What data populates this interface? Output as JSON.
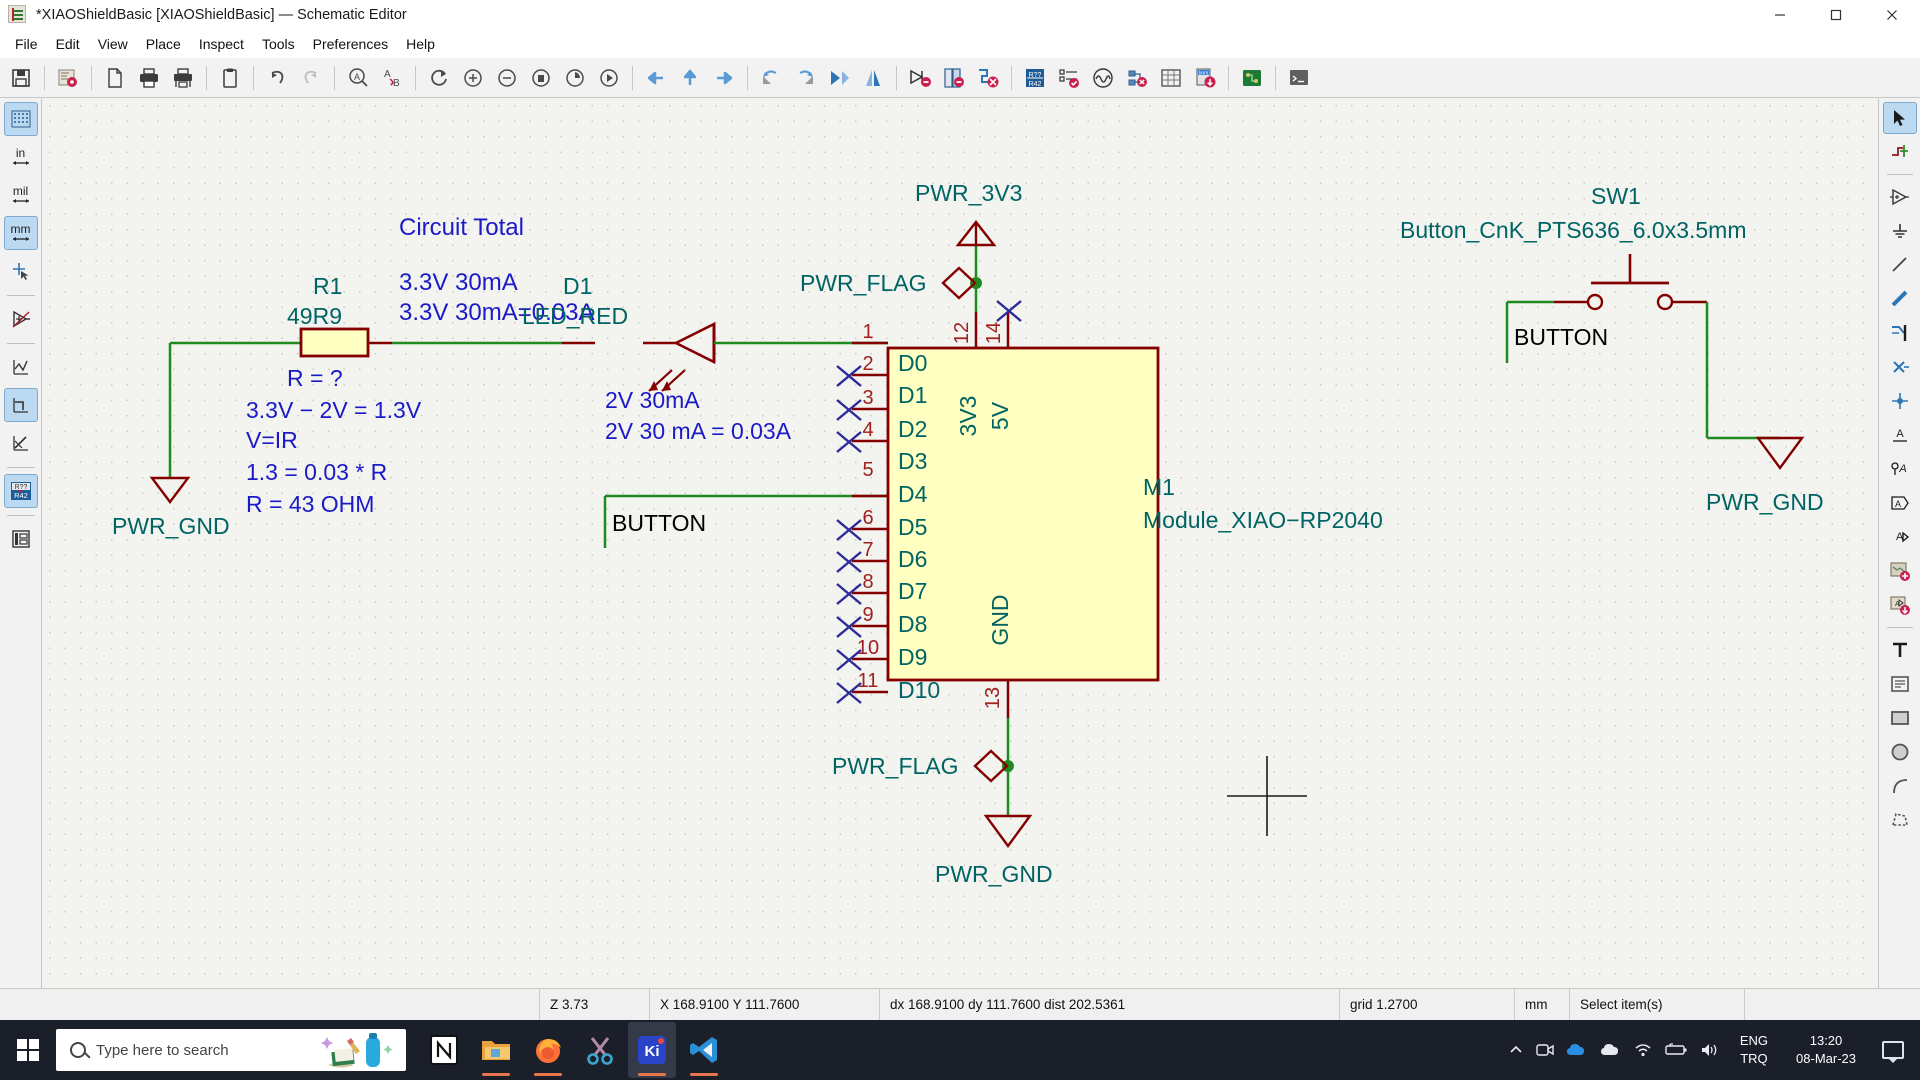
{
  "window": {
    "title": "*XIAOShieldBasic [XIAOShieldBasic] — Schematic Editor",
    "app_icon": "kicad-icon",
    "minimize": "—",
    "maximize": "❐",
    "close": "✕"
  },
  "menubar": {
    "items": [
      {
        "label": "File"
      },
      {
        "label": "Edit"
      },
      {
        "label": "View"
      },
      {
        "label": "Place"
      },
      {
        "label": "Inspect"
      },
      {
        "label": "Tools"
      },
      {
        "label": "Preferences"
      },
      {
        "label": "Help"
      }
    ]
  },
  "toolbar": {
    "buttons": [
      {
        "name": "save-icon"
      },
      {
        "name": "schematic-setup-icon"
      },
      {
        "name": "page-settings-icon"
      },
      {
        "name": "print-icon"
      },
      {
        "name": "plot-icon"
      },
      {
        "name": "paste-icon"
      },
      {
        "name": "undo-icon"
      },
      {
        "name": "redo-icon"
      },
      {
        "name": "find-icon"
      },
      {
        "name": "find-replace-icon"
      },
      {
        "name": "refresh-icon"
      },
      {
        "name": "zoom-in-icon"
      },
      {
        "name": "zoom-out-icon"
      },
      {
        "name": "zoom-fit-icon"
      },
      {
        "name": "zoom-objects-icon"
      },
      {
        "name": "zoom-selection-icon"
      },
      {
        "name": "leave-sheet-icon"
      },
      {
        "name": "up-sheet-icon"
      },
      {
        "name": "enter-sheet-icon"
      },
      {
        "name": "rotate-ccw-icon"
      },
      {
        "name": "rotate-cw-icon"
      },
      {
        "name": "mirror-horizontal-icon"
      },
      {
        "name": "mirror-vertical-icon"
      },
      {
        "name": "annotate-icon"
      },
      {
        "name": "symbol-checker-icon"
      },
      {
        "name": "erc-icon"
      },
      {
        "name": "assign-footprints-icon"
      },
      {
        "name": "edit-symbol-fields-icon"
      },
      {
        "name": "simulator-icon"
      },
      {
        "name": "netlist-icon"
      },
      {
        "name": "bom-table-icon"
      },
      {
        "name": "generate-bom-icon"
      },
      {
        "name": "open-pcb-icon"
      },
      {
        "name": "scripting-console-icon"
      }
    ]
  },
  "left_toolbar": {
    "buttons": [
      {
        "name": "toggle-grid-icon",
        "label": "",
        "active": true
      },
      {
        "name": "units-inch-icon",
        "label": "in",
        "active": false
      },
      {
        "name": "units-mil-icon",
        "label": "mil",
        "active": false
      },
      {
        "name": "units-mm-icon",
        "label": "mm",
        "active": true
      },
      {
        "name": "full-crosshair-icon",
        "label": "",
        "active": false
      },
      {
        "name": "invisible-pins-icon",
        "label": "",
        "active": false
      },
      {
        "name": "free-angle-lines-icon",
        "label": "",
        "active": false
      },
      {
        "name": "hv-lines-icon",
        "label": "",
        "active": true
      },
      {
        "name": "any-angle-lines-icon",
        "label": "",
        "active": false
      },
      {
        "name": "annotation-overlay-icon",
        "label": "R?? R42",
        "active": true
      },
      {
        "name": "hierarchy-navigator-icon",
        "label": "",
        "active": false
      }
    ]
  },
  "right_toolbar": {
    "buttons": [
      {
        "name": "select-tool-icon",
        "active": true
      },
      {
        "name": "highlight-net-icon",
        "active": false
      },
      {
        "name": "place-symbol-icon",
        "active": false
      },
      {
        "name": "place-power-icon",
        "active": false
      },
      {
        "name": "draw-wire-icon",
        "active": false
      },
      {
        "name": "draw-bus-icon",
        "active": false
      },
      {
        "name": "wire-to-bus-entry-icon",
        "active": false
      },
      {
        "name": "no-connect-flag-icon",
        "active": false
      },
      {
        "name": "junction-icon",
        "active": false
      },
      {
        "name": "net-label-icon",
        "active": false
      },
      {
        "name": "global-label-icon",
        "active": false
      },
      {
        "name": "hierarchical-label-icon",
        "active": false
      },
      {
        "name": "sheet-pin-icon",
        "active": false
      },
      {
        "name": "add-sheet-icon",
        "active": false
      },
      {
        "name": "import-sheet-pin-icon",
        "active": false
      },
      {
        "name": "add-text-icon",
        "active": false
      },
      {
        "name": "add-textbox-icon",
        "active": false
      },
      {
        "name": "draw-rectangle-icon",
        "active": false
      },
      {
        "name": "draw-circle-icon",
        "active": false
      },
      {
        "name": "draw-arc-icon",
        "active": false
      },
      {
        "name": "draw-polygon-icon",
        "active": false
      }
    ]
  },
  "schematic": {
    "notes": {
      "circuit_total_title": "Circuit Total",
      "circuit_total_line1": "3.3V 30mA",
      "circuit_total_line2": "3.3V 30mA=0.03A",
      "resistor_calc_q": "R = ?",
      "resistor_calc_l1": "3.3V − 2V = 1.3V",
      "resistor_calc_l2": "V=IR",
      "resistor_calc_l3": "1.3 = 0.03 * R",
      "resistor_calc_l4": "R = 43 OHM",
      "led_note_l1": "2V 30mA",
      "led_note_l2": "2V 30 mA = 0.03A"
    },
    "components": {
      "r1": {
        "ref": "R1",
        "value": "49R9"
      },
      "d1": {
        "ref": "D1",
        "value": "LED_RED"
      },
      "m1": {
        "ref": "M1",
        "value": "Module_XIAO−RP2040"
      },
      "sw1": {
        "ref": "SW1",
        "value": "Button_CnK_PTS636_6.0x3.5mm"
      }
    },
    "power_symbols": {
      "gnd_left": "PWR_GND",
      "gnd_bottom": "PWR_GND",
      "gnd_right": "PWR_GND",
      "pwr_3v3": "PWR_3V3",
      "pwr_flag_top": "PWR_FLAG",
      "pwr_flag_bottom": "PWR_FLAG"
    },
    "labels": {
      "button_left": "BUTTON",
      "button_right": "BUTTON"
    },
    "module_pins_left": [
      {
        "number": "1",
        "name": "D0",
        "connected": true
      },
      {
        "number": "2",
        "name": "D1",
        "connected": false
      },
      {
        "number": "3",
        "name": "D2",
        "connected": false
      },
      {
        "number": "4",
        "name": "D3",
        "connected": false
      },
      {
        "number": "5",
        "name": "D4",
        "connected": true
      },
      {
        "number": "6",
        "name": "D5",
        "connected": false
      },
      {
        "number": "7",
        "name": "D6",
        "connected": false
      },
      {
        "number": "8",
        "name": "D7",
        "connected": false
      },
      {
        "number": "9",
        "name": "D8",
        "connected": false
      },
      {
        "number": "10",
        "name": "D9",
        "connected": false
      },
      {
        "number": "11",
        "name": "D10",
        "connected": false
      }
    ],
    "module_pins_top": [
      {
        "number": "12",
        "name": "3V3",
        "connected": true
      },
      {
        "number": "14",
        "name": "5V",
        "connected": false
      }
    ],
    "module_pins_bottom": [
      {
        "number": "13",
        "name": "GND",
        "connected": true
      }
    ],
    "colors": {
      "wire_green": "#1f8a1f",
      "component_outline": "#840000",
      "component_fill": "#ffffc2",
      "pin_name_teal": "#006464",
      "pin_number_red": "#a02020",
      "note_blue": "#1a1ac8",
      "label_black": "#000000",
      "canvas_bg": "#f3f3ef"
    }
  },
  "statusbar": {
    "zoom": "Z 3.73",
    "cursor": "X 168.9100  Y 111.7600",
    "delta": "dx 168.9100  dy 111.7600  dist 202.5361",
    "grid": "grid 1.2700",
    "units": "mm",
    "tool": "Select item(s)"
  },
  "taskbar": {
    "search_placeholder": "Type here to search",
    "apps": [
      {
        "name": "notion-app",
        "label": "N"
      },
      {
        "name": "file-explorer-app",
        "label": ""
      },
      {
        "name": "firefox-app",
        "label": ""
      },
      {
        "name": "snipping-tool-app",
        "label": ""
      },
      {
        "name": "kicad-app",
        "label": "Ki"
      },
      {
        "name": "vscode-app",
        "label": ""
      }
    ],
    "tray": {
      "language_l1": "ENG",
      "language_l2": "TRQ",
      "time": "13:20",
      "date": "08-Mar-23"
    }
  }
}
